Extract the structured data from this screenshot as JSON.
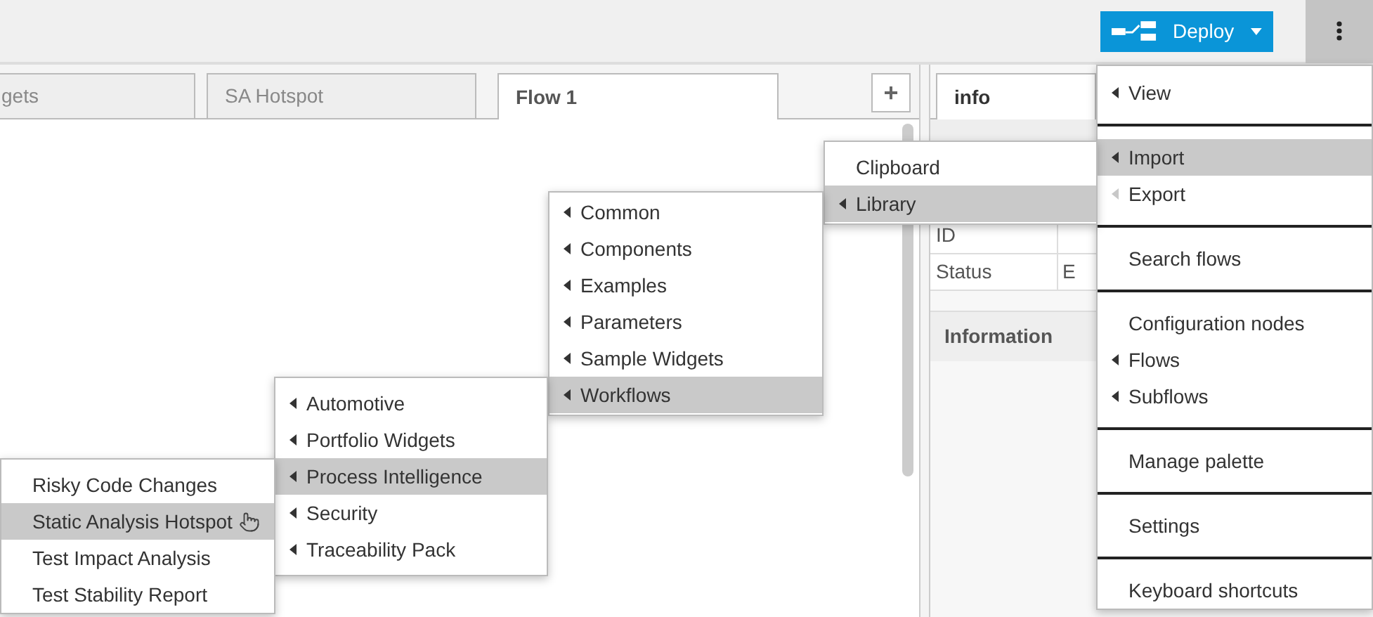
{
  "header": {
    "deploy_button": "Deploy"
  },
  "workspace_tabs": [
    {
      "label": "gets",
      "selected": false
    },
    {
      "label": "SA Hotspot",
      "selected": false
    },
    {
      "label": "Flow 1",
      "selected": true
    }
  ],
  "add_tab_button": "+",
  "sidebar": {
    "tabs": [
      {
        "label": "info",
        "selected": true
      }
    ],
    "rows": [
      {
        "label": "ID",
        "value": ""
      },
      {
        "label": "Status",
        "value": "E"
      }
    ],
    "section": "Information"
  },
  "menus": [
    {
      "items": [
        {
          "label": "View",
          "submenu": true,
          "selected": false,
          "divider_after": true
        },
        {
          "label": "Import",
          "submenu": true,
          "selected": true,
          "divider_after": false
        },
        {
          "label": "Export",
          "submenu": true,
          "selected": false,
          "arrow_dimmed": true,
          "divider_after": true
        },
        {
          "label": "Search flows",
          "submenu": false,
          "selected": false,
          "divider_after": true
        },
        {
          "label": "Configuration nodes",
          "submenu": false,
          "selected": false,
          "divider_after": false
        },
        {
          "label": "Flows",
          "submenu": true,
          "selected": false,
          "divider_after": false
        },
        {
          "label": "Subflows",
          "submenu": true,
          "selected": false,
          "divider_after": true
        },
        {
          "label": "Manage palette",
          "submenu": false,
          "selected": false,
          "divider_after": true
        },
        {
          "label": "Settings",
          "submenu": false,
          "selected": false,
          "divider_after": true
        },
        {
          "label": "Keyboard shortcuts",
          "submenu": false,
          "selected": false,
          "divider_after": false
        }
      ]
    },
    {
      "items": [
        {
          "label": "Clipboard",
          "submenu": false,
          "selected": false
        },
        {
          "label": "Library",
          "submenu": true,
          "selected": true
        }
      ]
    },
    {
      "items": [
        {
          "label": "Common",
          "submenu": true,
          "selected": false
        },
        {
          "label": "Components",
          "submenu": true,
          "selected": false
        },
        {
          "label": "Examples",
          "submenu": true,
          "selected": false
        },
        {
          "label": "Parameters",
          "submenu": true,
          "selected": false
        },
        {
          "label": "Sample Widgets",
          "submenu": true,
          "selected": false
        },
        {
          "label": "Workflows",
          "submenu": true,
          "selected": true
        }
      ]
    },
    {
      "items": [
        {
          "label": "Automotive",
          "submenu": true,
          "selected": false
        },
        {
          "label": "Portfolio Widgets",
          "submenu": true,
          "selected": false
        },
        {
          "label": "Process Intelligence",
          "submenu": true,
          "selected": true
        },
        {
          "label": "Security",
          "submenu": true,
          "selected": false
        },
        {
          "label": "Traceability Pack",
          "submenu": true,
          "selected": false
        }
      ]
    },
    {
      "items": [
        {
          "label": "Risky Code Changes",
          "submenu": false,
          "selected": false
        },
        {
          "label": "Static Analysis Hotspot",
          "submenu": false,
          "selected": true,
          "hovered": true
        },
        {
          "label": "Test Impact Analysis",
          "submenu": false,
          "selected": false
        },
        {
          "label": "Test Stability Report",
          "submenu": false,
          "selected": false
        }
      ]
    }
  ]
}
